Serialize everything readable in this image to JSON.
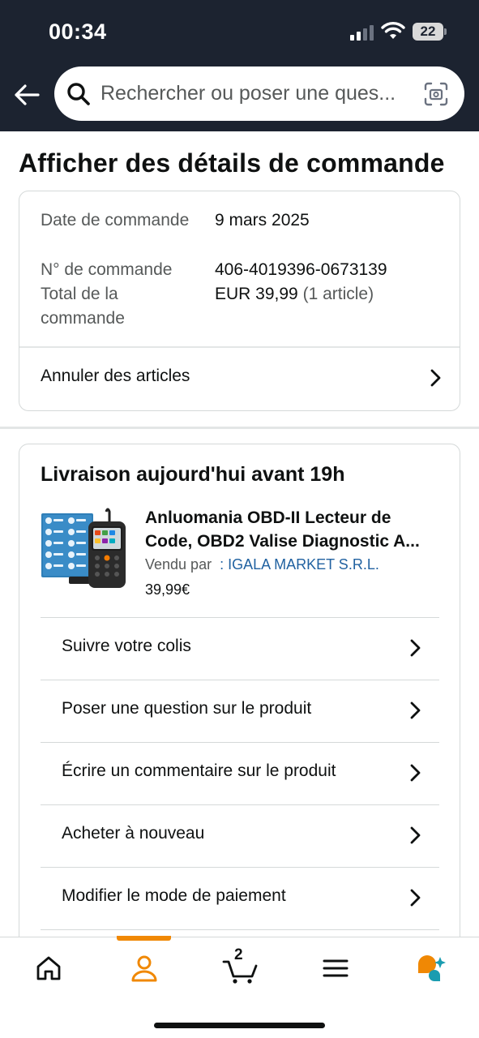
{
  "status_bar": {
    "time": "00:34",
    "battery": "22"
  },
  "search": {
    "placeholder": "Rechercher ou poser une ques..."
  },
  "page": {
    "title": "Afficher des détails de commande"
  },
  "order_summary": {
    "date_label": "Date de commande",
    "date_value": "9 mars 2025",
    "number_label": "N° de commande",
    "number_value": "406-4019396-0673139",
    "total_label": "Total de la commande",
    "total_value": "EUR 39,99",
    "total_items": "(1 article)",
    "cancel_label": "Annuler des articles"
  },
  "shipment": {
    "delivery_title": "Livraison aujourd'hui avant 19h",
    "product_title_line1": "Anluomania OBD-II Lecteur de",
    "product_title_line2": "Code, OBD2 Valise Diagnostic A...",
    "sold_by_label": "Vendu par",
    "seller": ": IGALA MARKET S.R.L.",
    "price": "39,99€",
    "actions": [
      {
        "label": "Suivre votre colis"
      },
      {
        "label": "Poser une question sur le produit"
      },
      {
        "label": "Écrire un commentaire sur le produit"
      },
      {
        "label": "Acheter à nouveau"
      },
      {
        "label": "Modifier le mode de paiement"
      }
    ]
  },
  "bottom_nav": {
    "cart_count": "2",
    "accent_color": "#f08804",
    "icons": [
      "home-icon",
      "account-icon",
      "cart-icon",
      "menu-icon",
      "rufus-icon"
    ]
  }
}
